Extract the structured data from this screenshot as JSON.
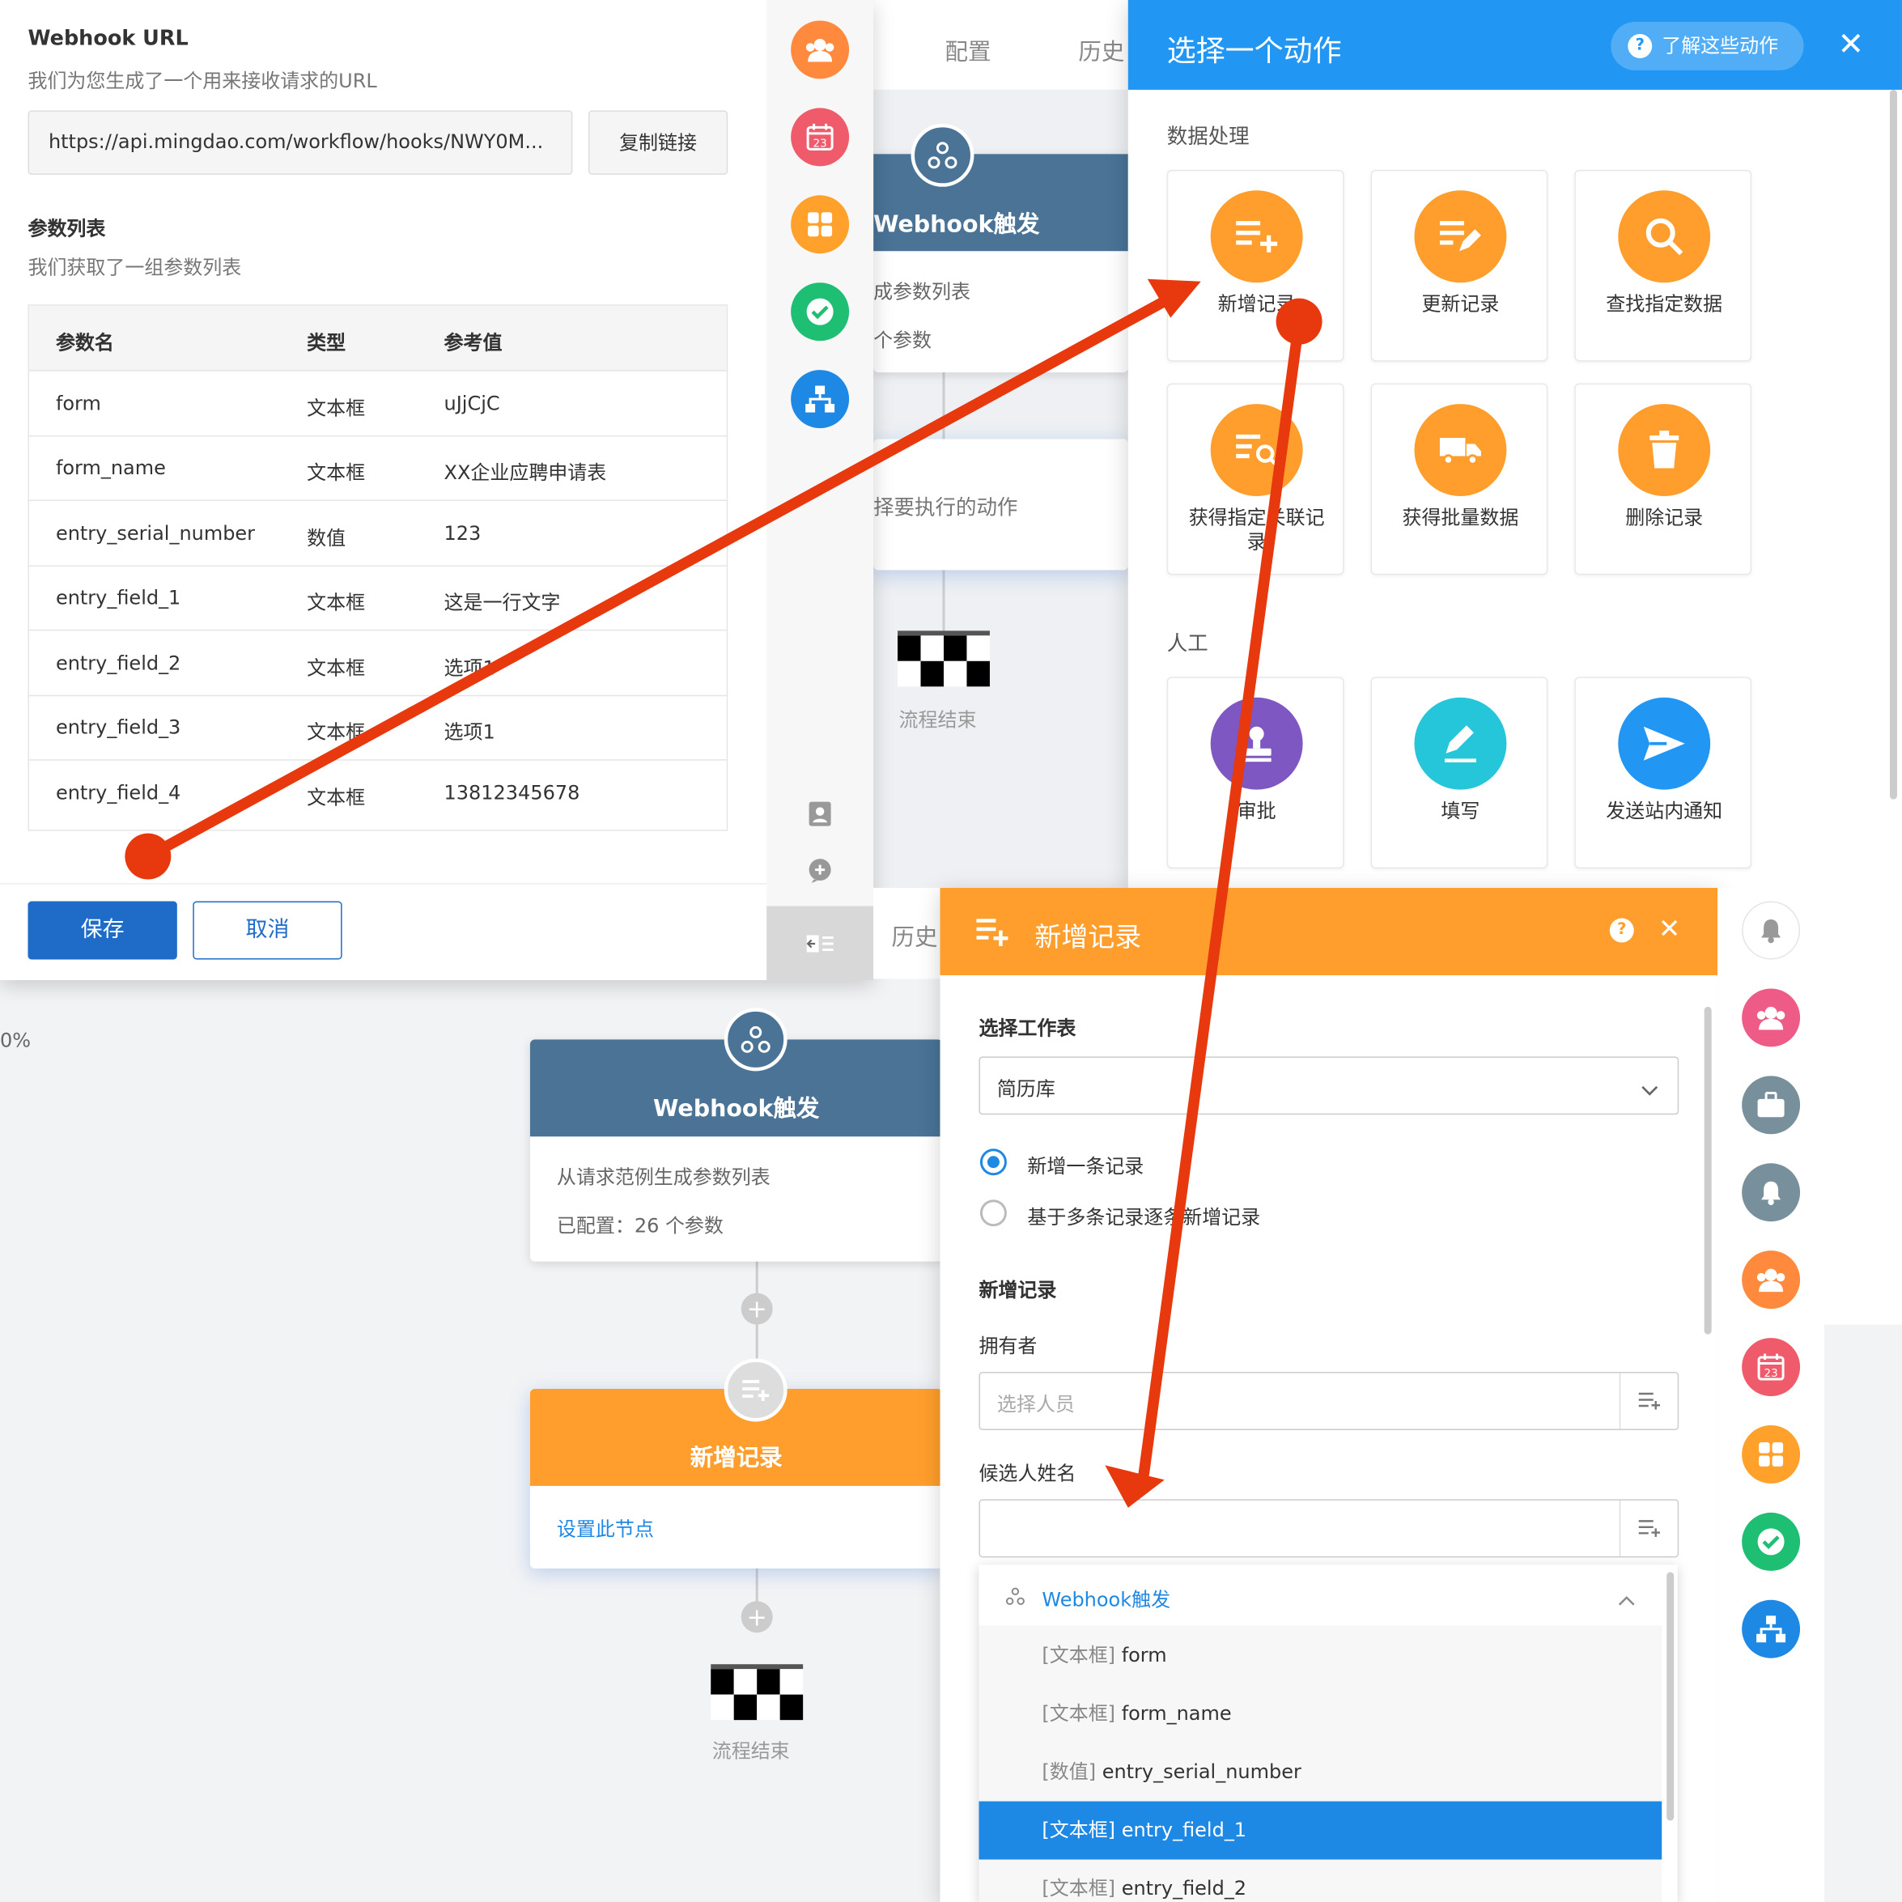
{
  "webhook_panel": {
    "url_title": "Webhook URL",
    "url_desc": "我们为您生成了一个用来接收请求的URL",
    "url_value": "https://api.mingdao.com/workflow/hooks/NWY0M...",
    "copy_label": "复制链接",
    "params_title": "参数列表",
    "params_desc": "我们获取了一组参数列表",
    "columns": [
      "参数名",
      "类型",
      "参考值"
    ],
    "rows": [
      {
        "name": "form",
        "type": "文本框",
        "value": "uJjCjC"
      },
      {
        "name": "form_name",
        "type": "文本框",
        "value": "XX企业应聘申请表"
      },
      {
        "name": "entry_serial_number",
        "type": "数值",
        "value": "123"
      },
      {
        "name": "entry_field_1",
        "type": "文本框",
        "value": "这是一行文字"
      },
      {
        "name": "entry_field_2",
        "type": "文本框",
        "value": "选项1"
      },
      {
        "name": "entry_field_3",
        "type": "文本框",
        "value": "选项1"
      },
      {
        "name": "entry_field_4",
        "type": "文本框",
        "value": "13812345678"
      }
    ],
    "save_label": "保存",
    "cancel_label": "取消"
  },
  "behind": {
    "tab_config": "配置",
    "tab_history": "历史",
    "tab_history_2": "历史",
    "zoom_fragment": "0%",
    "top_webhook_title": "Webhook触发",
    "top_webhook_line1": "成参数列表",
    "top_webhook_line2": "个参数",
    "top_action_text": "择要执行的动作",
    "top_end_label": "流程结束"
  },
  "flow": {
    "webhook_title": "Webhook触发",
    "webhook_line1": "从请求范例生成参数列表",
    "webhook_line2": "已配置：26 个参数",
    "add_record_title": "新增记录",
    "add_record_link": "设置此节点",
    "end_label": "流程结束"
  },
  "action_picker": {
    "title": "选择一个动作",
    "learn_label": "了解这些动作",
    "section_data": "数据处理",
    "section_manual": "人工",
    "data_actions": [
      {
        "label": "新增记录",
        "icon": "add-record-icon",
        "color": "#ff9e2c"
      },
      {
        "label": "更新记录",
        "icon": "edit-record-icon",
        "color": "#ff9e2c"
      },
      {
        "label": "查找指定数据",
        "icon": "search-icon",
        "color": "#ff9e2c"
      },
      {
        "label": "获得指定关联记录",
        "icon": "related-record-icon",
        "color": "#ff9e2c"
      },
      {
        "label": "获得批量数据",
        "icon": "truck-icon",
        "color": "#ff9e2c"
      },
      {
        "label": "删除记录",
        "icon": "trash-icon",
        "color": "#ff9e2c"
      }
    ],
    "manual_actions": [
      {
        "label": "审批",
        "icon": "stamp-icon",
        "color": "#7e57c2"
      },
      {
        "label": "填写",
        "icon": "pencil-icon",
        "color": "#26c6da"
      },
      {
        "label": "发送站内通知",
        "icon": "send-icon",
        "color": "#2196f3"
      }
    ]
  },
  "new_record_panel": {
    "title": "新增记录",
    "select_sheet_label": "选择工作表",
    "sheet_value": "简历库",
    "radio_single": "新增一条记录",
    "radio_multi": "基于多条记录逐条新增记录",
    "section_label": "新增记录",
    "owner_label": "拥有者",
    "owner_placeholder": "选择人员",
    "candidate_label": "候选人姓名",
    "dropdown_group": "Webhook触发",
    "dropdown_items": [
      {
        "type": "[文本框]",
        "name": "form"
      },
      {
        "type": "[文本框]",
        "name": "form_name"
      },
      {
        "type": "[数值]",
        "name": "entry_serial_number"
      },
      {
        "type": "[文本框]",
        "name": "entry_field_1"
      },
      {
        "type": "[文本框]",
        "name": "entry_field_2"
      }
    ],
    "highlighted_item": "entry_field_1"
  },
  "left_icon_bar": [
    "team-icon",
    "calendar-icon",
    "grid-icon",
    "check-icon",
    "org-chart-icon",
    "contact-icon",
    "chat-icon",
    "collapse-icon"
  ],
  "right_icon_bar": [
    "bell-icon",
    "team-icon",
    "briefcase-icon",
    "bell-icon",
    "team-icon",
    "calendar-icon",
    "grid-icon",
    "check-icon",
    "org-chart-icon"
  ],
  "calendar_day": "23",
  "colors": {
    "primary_blue": "#1e6cc8",
    "picker_blue": "#2196f3",
    "orange": "#ff9e2c",
    "flow_header": "#4a7396",
    "annotation_red": "#e8380d",
    "highlight": "#1e88e5"
  }
}
